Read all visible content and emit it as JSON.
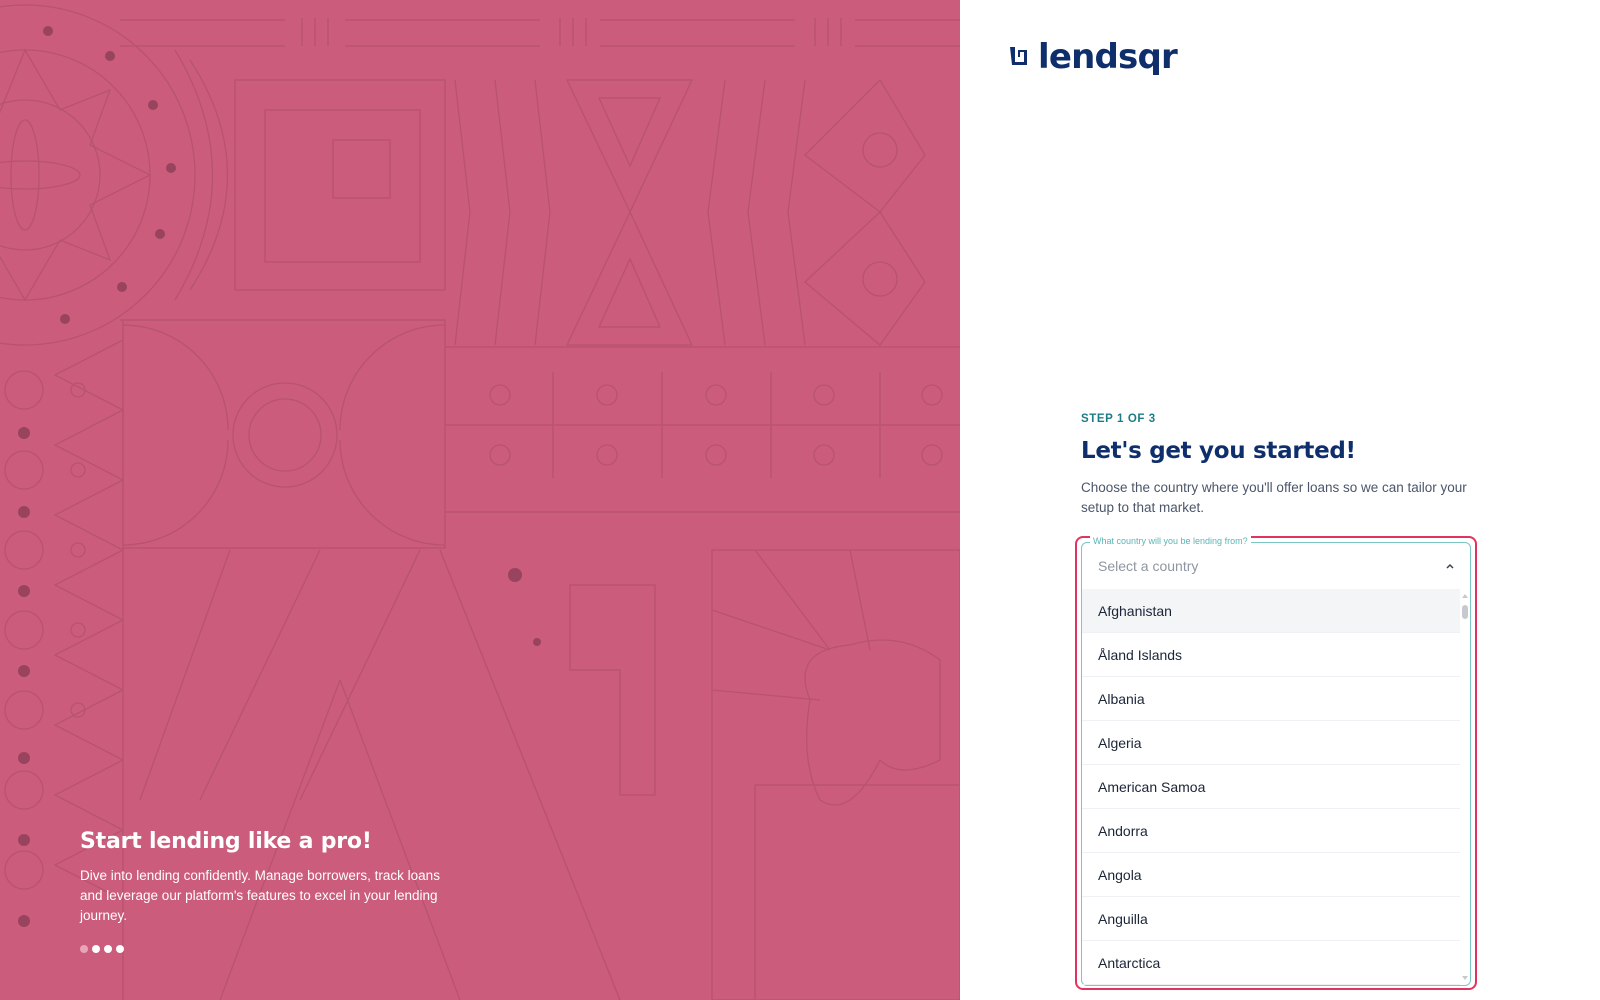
{
  "brand": {
    "name": "lendsqr",
    "color": "#0f2f6c",
    "accent": "#cb5c7b"
  },
  "hero": {
    "title": "Start lending like a pro!",
    "text": "Dive into lending confidently. Manage borrowers, track loans and leverage our platform's features to excel in your lending journey."
  },
  "form": {
    "step": "STEP 1 OF 3",
    "title": "Let's get you started!",
    "description": "Choose the country where you'll offer loans so we can tailor your setup to that market.",
    "country_label": "What country will you be lending from?",
    "country_placeholder": "Select a country",
    "options": [
      "Afghanistan",
      "Åland Islands",
      "Albania",
      "Algeria",
      "American Samoa",
      "Andorra",
      "Angola",
      "Anguilla",
      "Antarctica"
    ]
  },
  "icons": {
    "chevron": "chevron-up-icon",
    "logo": "lendsqr-logo-icon"
  }
}
